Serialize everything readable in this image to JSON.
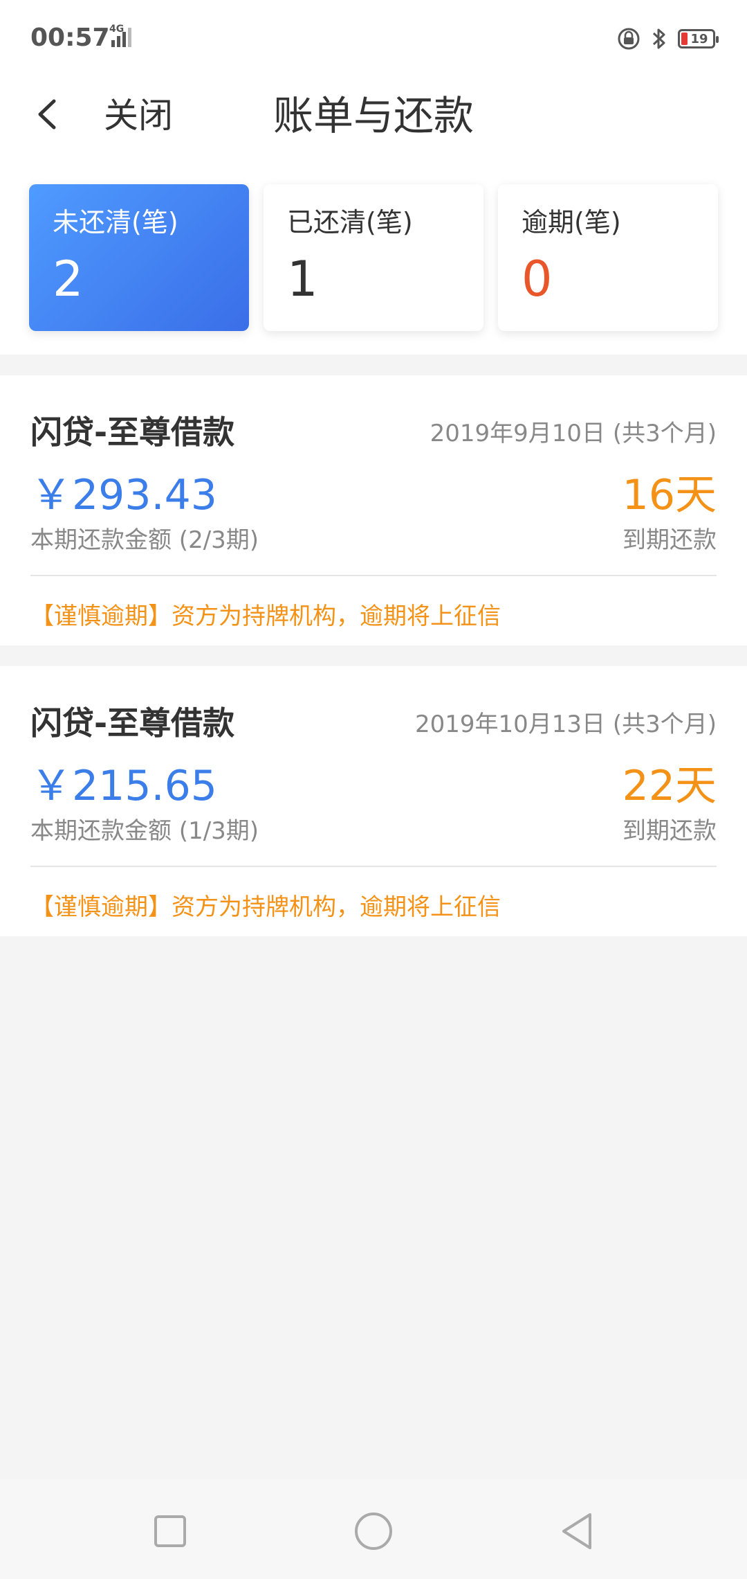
{
  "status_bar": {
    "time": "00:57",
    "network": "4G",
    "battery": "19"
  },
  "header": {
    "close_label": "关闭",
    "title": "账单与还款"
  },
  "summary": {
    "unpaid": {
      "label": "未还清(笔)",
      "count": "2"
    },
    "paid": {
      "label": "已还清(笔)",
      "count": "1"
    },
    "overdue": {
      "label": "逾期(笔)",
      "count": "0"
    }
  },
  "loans": [
    {
      "title": "闪贷-至尊借款",
      "date": "2019年9月10日 (共3个月)",
      "amount": "￥293.43",
      "days": "16天",
      "period_text": "本期还款金额 (2/3期)",
      "due_text": "到期还款",
      "notice": "【谨慎逾期】资方为持牌机构，逾期将上征信"
    },
    {
      "title": "闪贷-至尊借款",
      "date": "2019年10月13日 (共3个月)",
      "amount": "￥215.65",
      "days": "22天",
      "period_text": "本期还款金额 (1/3期)",
      "due_text": "到期还款",
      "notice": "【谨慎逾期】资方为持牌机构，逾期将上征信"
    }
  ],
  "icons": {
    "back": "chevron-left-icon",
    "lock": "lock-rotation-icon",
    "bluetooth": "bluetooth-icon",
    "battery": "battery-icon",
    "signal": "signal-icon",
    "nav_recent": "square-icon",
    "nav_home": "circle-icon",
    "nav_back": "triangle-back-icon"
  },
  "colors": {
    "accent_blue": "#3b7de9",
    "orange": "#f39216",
    "red": "#e8562a"
  }
}
